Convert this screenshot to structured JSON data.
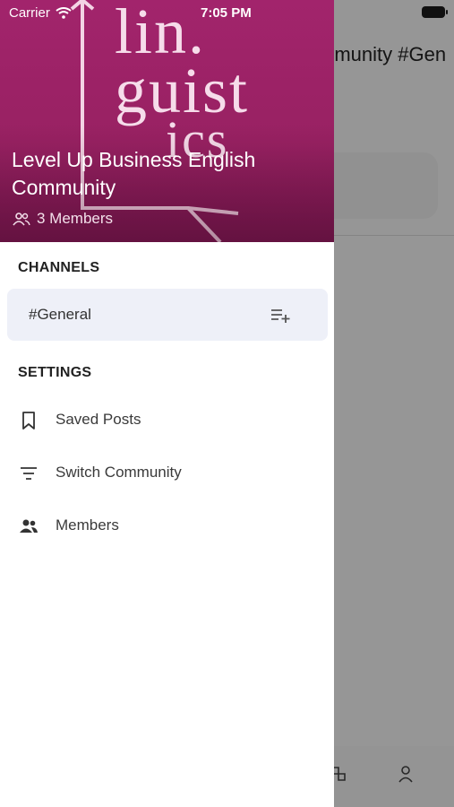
{
  "status_bar": {
    "carrier": "Carrier",
    "time": "7:05 PM"
  },
  "background": {
    "title": "mmunity #Gen"
  },
  "drawer": {
    "logo": {
      "line1": "lin.",
      "line2": "guist",
      "line3": "ics"
    },
    "community_name": "Level Up Business English Community",
    "members_count": "3 Members",
    "channels_title": "CHANNELS",
    "channels": [
      {
        "label": "#General"
      }
    ],
    "settings_title": "SETTINGS",
    "settings_items": [
      {
        "label": "Saved Posts",
        "icon": "bookmark-icon"
      },
      {
        "label": "Switch Community",
        "icon": "filter-list-icon"
      },
      {
        "label": "Members",
        "icon": "people-icon"
      }
    ]
  },
  "colors": {
    "header": "#9c2266",
    "channel_bg": "#eef0f8",
    "overlay": "rgba(0,0,0,0.40)"
  }
}
